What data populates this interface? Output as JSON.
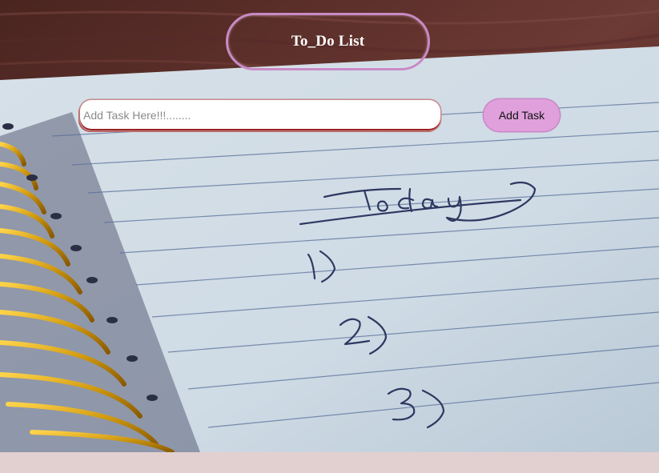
{
  "header": {
    "title": "To_Do List"
  },
  "task_form": {
    "input_value": "",
    "input_placeholder": "Add Task Here!!!........",
    "add_label": "Add Task"
  },
  "background": {
    "image": "spiral-notebook-photo",
    "handwriting": [
      "Today",
      "1)",
      "2)",
      "3)"
    ]
  },
  "colors": {
    "title_border": "#c98ac6",
    "add_button": "#dfa0dc",
    "page_background": "#e2d0d0"
  }
}
